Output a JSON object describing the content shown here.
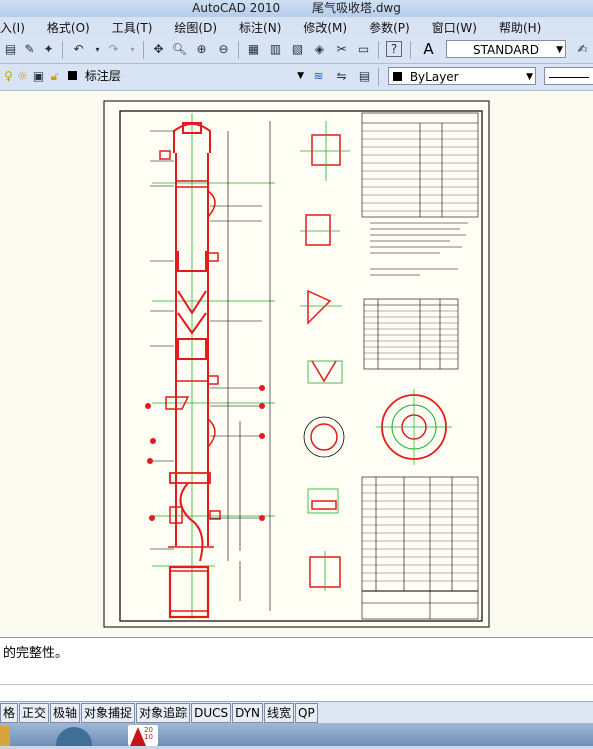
{
  "window": {
    "app": "AutoCAD 2010",
    "file": "尾气吸收塔.dwg"
  },
  "menu": {
    "items": [
      "入(I)",
      "格式(O)",
      "工具(T)",
      "绘图(D)",
      "标注(N)",
      "修改(M)",
      "参数(P)",
      "窗口(W)",
      "帮助(H)"
    ]
  },
  "toolbar1": {
    "text_style": "STANDARD"
  },
  "toolbar2": {
    "layer": "标注层",
    "color": "ByLayer"
  },
  "command": {
    "line1": "的完整性。"
  },
  "status": {
    "buttons": [
      "格",
      "正交",
      "极轴",
      "对象捕捉",
      "对象追踪",
      "DUCS",
      "DYN",
      "线宽",
      "QP"
    ]
  },
  "taskbar": {
    "icon2_text": "20 10"
  },
  "colors": {
    "drawing_bg": "#fbfaf1",
    "red": "#e21b1b",
    "green": "#1fae2c",
    "black": "#000000"
  }
}
